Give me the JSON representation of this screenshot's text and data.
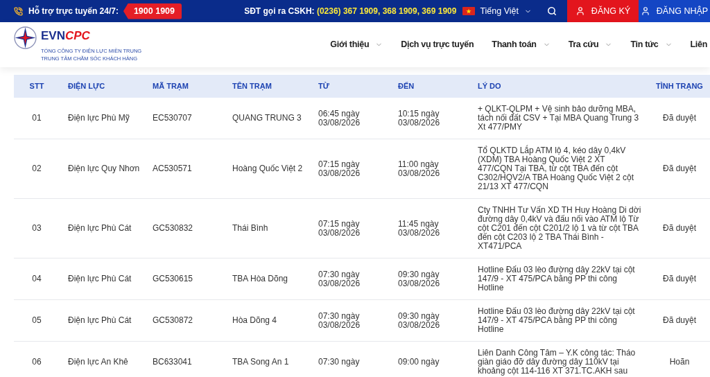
{
  "top_bar": {
    "support": {
      "label": "Hỗ trợ trực tuyến 24/7:",
      "hotline": "1900 1909"
    },
    "outbound": {
      "label": "SĐT gọi ra CSKH:",
      "numbers": "(0236) 367 1909, 368 1909, 369 1909"
    },
    "language": "Tiếng Việt",
    "buttons": [
      {
        "kind": "register",
        "label": "ĐĂNG KÝ"
      },
      {
        "kind": "login",
        "label": "ĐĂNG NHẬP"
      }
    ]
  },
  "header": {
    "logo": {
      "brand_first": "EVN",
      "brand_second": "CPC",
      "line_1": "TỔNG CÔNG TY ĐIỆN LỰC MIỀN TRUNG",
      "line_2": "TRUNG TÂM CHĂM SÓC KHÁCH HÀNG"
    },
    "nav": [
      {
        "label": "Giới thiệu",
        "has_dropdown": true
      },
      {
        "label": "Dịch vụ trực tuyến",
        "has_dropdown": false
      },
      {
        "label": "Thanh toán",
        "has_dropdown": true
      },
      {
        "label": "Tra cứu",
        "has_dropdown": true
      },
      {
        "label": "Tin tức",
        "has_dropdown": true
      },
      {
        "label": "Liên",
        "has_dropdown": false
      }
    ]
  },
  "table": {
    "columns": [
      "STT",
      "ĐIỆN LỰC",
      "MÃ TRẠM",
      "TÊN TRẠM",
      "TỪ",
      "ĐẾN",
      "LÝ DO",
      "TÌNH TRẠNG"
    ],
    "rows": [
      {
        "number": "01",
        "branch": "Điện lực Phù Mỹ",
        "station_code": "EC530707",
        "station_name": "QUANG TRUNG 3",
        "from": "06:45 ngày 03/08/2026",
        "to": "10:15 ngày 03/08/2026",
        "reason": "+ QLKT-QLPM + Vệ sinh bảo dưỡng MBA, tách nối đất CSV + Tại MBA Quang Trung 3 Xt 477/PMY",
        "status": "Đã duyệt"
      },
      {
        "number": "02",
        "branch": "Điện lực Quy Nhơn",
        "station_code": "AC530571",
        "station_name": "Hoàng Quốc Việt 2",
        "from": "07:15 ngày 03/08/2026",
        "to": "11:00 ngày 03/08/2026",
        "reason": "Tổ QLKTD Lắp ATM lộ 4, kéo dây 0,4kV (XDM) TBA Hoàng Quốc Việt 2 XT 477/CQN Tại TBA, từ cột TBA đến cột C302/HQV2/A TBA Hoàng Quốc Việt 2 cột 21/13 XT 477/CQN",
        "status": "Đã duyệt"
      },
      {
        "number": "03",
        "branch": "Điện lực Phù Cát",
        "station_code": "GC530832",
        "station_name": "Thái Bình",
        "from": "07:15 ngày 03/08/2026",
        "to": "11:45 ngày 03/08/2026",
        "reason": "Cty TNHH Tư Vấn XD TH Huy Hoàng Di dời đường dây 0,4kV và đấu nối vào ATM lộ Từ cột C201 đến cột C201/2 lộ 1 và từ cột TBA đến cột C203 lộ 2 TBA Thái Bình - XT471/PCA",
        "status": "Đã duyệt"
      },
      {
        "number": "04",
        "branch": "Điện lực Phù Cát",
        "station_code": "GC530615",
        "station_name": "TBA Hòa Dõng",
        "from": "07:30 ngày 03/08/2026",
        "to": "09:30 ngày 03/08/2026",
        "reason": "Hotline Đấu 03 lèo đường dây 22kV tại cột 147/9 - XT 475/PCA bằng PP thi công Hotline",
        "status": "Đã duyệt"
      },
      {
        "number": "05",
        "branch": "Điện lực Phù Cát",
        "station_code": "GC530872",
        "station_name": "Hòa Dõng 4",
        "from": "07:30 ngày 03/08/2026",
        "to": "09:30 ngày 03/08/2026",
        "reason": "Hotline Đấu 03 lèo đường dây 22kV tại cột 147/9 - XT 475/PCA bằng PP thi công Hotline",
        "status": "Đã duyệt"
      },
      {
        "number": "06",
        "branch": "Điện lực An Khê",
        "station_code": "BC633041",
        "station_name": "TBA Song An 1",
        "from": "07:30 ngày",
        "to": "09:00 ngày",
        "reason": "Liên Danh Công Tâm – Y.K công tác: Tháo giàn giáo đỡ dây đường dây 110kV tại khoảng cột 114-116 XT 371.TC.AKH sau",
        "status": "Hoãn"
      }
    ]
  }
}
